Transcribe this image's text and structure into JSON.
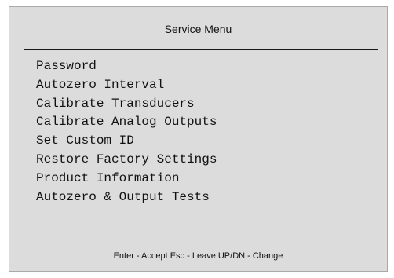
{
  "menu": {
    "title": "Service Menu",
    "items": [
      "Password",
      "Autozero Interval",
      "Calibrate Transducers",
      "Calibrate Analog Outputs",
      "Set Custom ID",
      "Restore Factory Settings",
      "Product Information",
      "Autozero & Output Tests"
    ],
    "footer": "Enter - Accept Esc - Leave UP/DN - Change"
  }
}
